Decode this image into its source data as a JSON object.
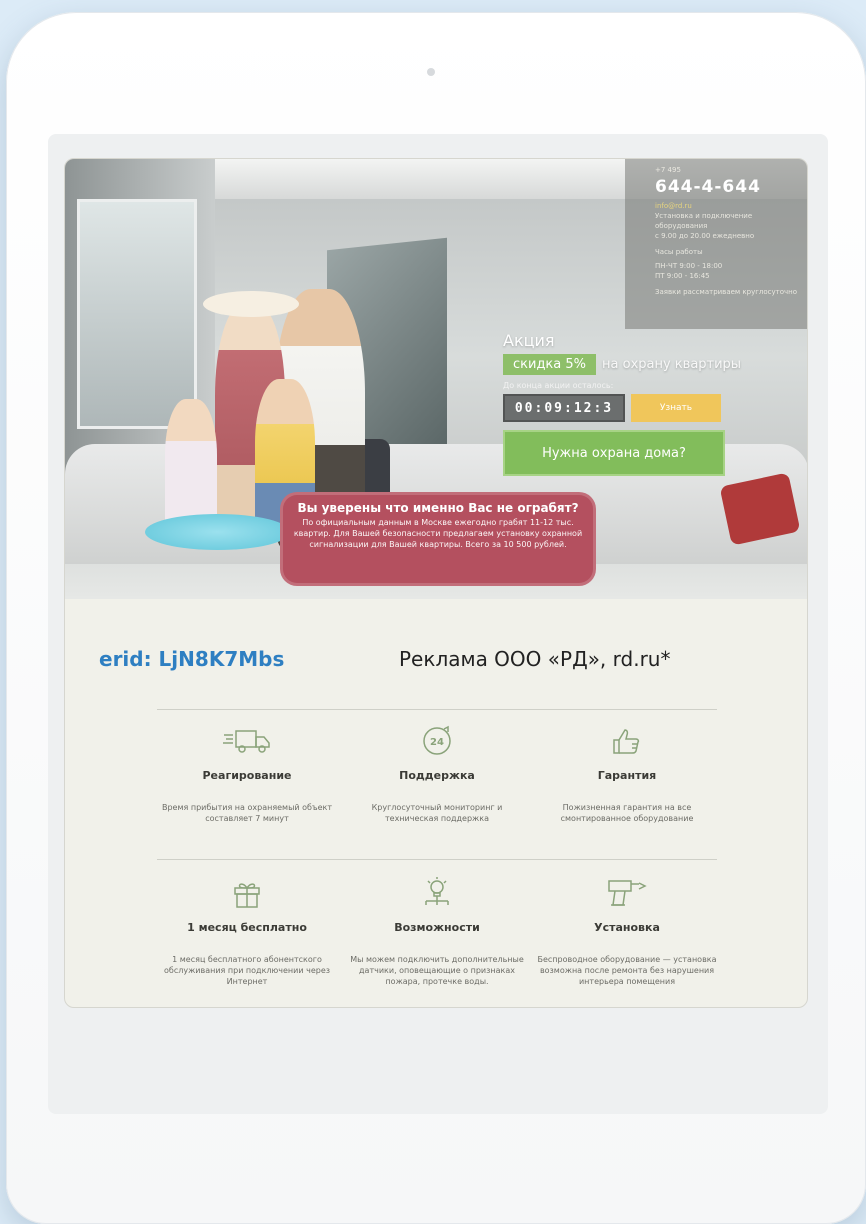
{
  "contact": {
    "code": "+7 495",
    "phone": "644-4-644",
    "email": "info@rd.ru",
    "lines": [
      "Установка и подключение",
      "оборудования",
      "с 9.00 до 20.00 ежедневно"
    ],
    "hours_label": "Часы работы",
    "hours_1": "ПН-ЧТ 9:00 - 18:00",
    "hours_2": "ПТ 9:00 - 16:45",
    "note": "Заявки рассматриваем круглосуточно"
  },
  "promo": {
    "title": "Акция",
    "discount": "скидка 5%",
    "rest": "на охрану квартиры",
    "left_text": "До конца акции осталось:",
    "timer": "00:09:12:3",
    "know_button": "Узнать",
    "guard_button": "Нужна охрана дома?"
  },
  "banner": {
    "headline": "Вы уверены что именно Вас не ограбят?",
    "text": "По официальным данным в Москве ежегодно грабят 11-12 тыс. квартир. Для Вашей безопасности предлагаем установку охранной сигнализации для Вашей квартиры. Всего за 10 500 рублей."
  },
  "ad": {
    "erid": "erid: LjN8K7Mbs",
    "text": "Реклама ООО «РД», rd.ru*"
  },
  "features": [
    {
      "title": "Реагирование",
      "desc": "Время прибытия на охраняемый объект составляет 7 минут",
      "icon": "truck-icon"
    },
    {
      "title": "Поддержка",
      "desc": "Круглосуточный мониторинг и техническая поддержка",
      "icon": "24h-icon"
    },
    {
      "title": "Гарантия",
      "desc": "Пожизненная гарантия на все смонтированное оборудование",
      "icon": "thumbs-up-icon"
    },
    {
      "title": "1 месяц бесплатно",
      "desc": "1 месяц бесплатного абонентского обслуживания при подключении через Интернет",
      "icon": "gift-icon"
    },
    {
      "title": "Возможности",
      "desc": "Мы можем подключить дополнительные датчики, оповещающие о признаках пожара, протечке воды.",
      "icon": "bulb-icon"
    },
    {
      "title": "Установка",
      "desc": "Беспроводное оборудование — установка возможна после ремонта без нарушения интерьера помещения",
      "icon": "drill-icon"
    }
  ]
}
